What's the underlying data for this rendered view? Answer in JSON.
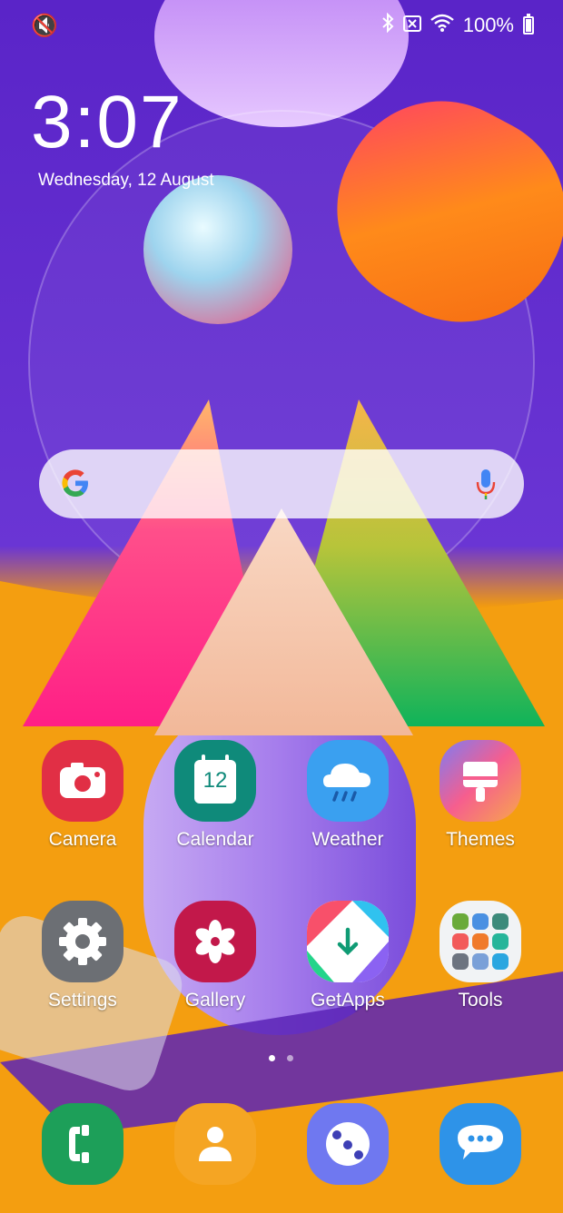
{
  "status_bar": {
    "left_icon": "mute-vibrate-icon",
    "right_icons": [
      "bluetooth-icon",
      "no-sim-icon",
      "wifi-icon"
    ],
    "battery_text": "100%"
  },
  "clock": {
    "time": "3:07",
    "date": "Wednesday, 12 August"
  },
  "search": {
    "logo": "google-g-icon",
    "mic": "microphone-icon"
  },
  "apps": [
    {
      "label": "Camera",
      "icon": "camera-icon",
      "color": "#e12f45"
    },
    {
      "label": "Calendar",
      "icon": "calendar-icon",
      "color": "#0f8a7a",
      "day": "12"
    },
    {
      "label": "Weather",
      "icon": "weather-icon",
      "color": "#3aa0f0"
    },
    {
      "label": "Themes",
      "icon": "themes-icon",
      "color": "#f0659a"
    },
    {
      "label": "Settings",
      "icon": "settings-icon",
      "color": "#6c6f74"
    },
    {
      "label": "Gallery",
      "icon": "gallery-icon",
      "color": "#c2184a"
    },
    {
      "label": "GetApps",
      "icon": "getapps-icon",
      "color": "#30c2ef"
    },
    {
      "label": "Tools",
      "icon": "tools-folder-icon",
      "color": "#f1f3f5"
    }
  ],
  "page_indicator": {
    "pages": 2,
    "current": 1
  },
  "dock": [
    {
      "icon": "phone-icon",
      "color": "#1d9f59"
    },
    {
      "icon": "contacts-icon",
      "color": "#f5a523"
    },
    {
      "icon": "bixby-icon",
      "color": "#6f78f0"
    },
    {
      "icon": "messages-icon",
      "color": "#2e93e8"
    }
  ]
}
